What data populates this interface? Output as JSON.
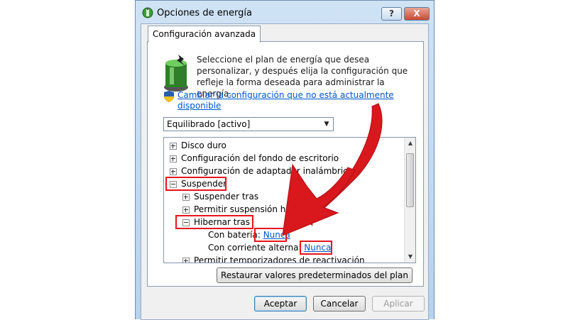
{
  "window": {
    "title": "Opciones de energía",
    "help_label": "?",
    "close_label": "X"
  },
  "tab": {
    "label": "Configuración avanzada"
  },
  "description": "Seleccione el plan de energía que desea personalizar, y después elija la configuración que refleje la forma deseada para administrar la energía.",
  "change_link": "Cambiar la configuración que no está actualmente disponible",
  "plan_select": {
    "value": "Equilibrado [activo]"
  },
  "tree": {
    "items": [
      {
        "label": "Disco duro",
        "expander": "plus"
      },
      {
        "label": "Configuración del fondo de escritorio",
        "expander": "plus"
      },
      {
        "label": "Configuración de adaptador inalámbrico",
        "expander": "plus"
      },
      {
        "label": "Suspender",
        "expander": "minus"
      },
      {
        "label": "Suspender tras",
        "expander": "plus"
      },
      {
        "label": "Permitir suspensión híbrida",
        "expander": "plus"
      },
      {
        "label": "Hibernar tras",
        "expander": "minus"
      },
      {
        "label": "Con batería:",
        "value": "Nunca"
      },
      {
        "label": "Con corriente alterna:",
        "value": "Nunca"
      },
      {
        "label": "Permitir temporizadores de reactivación",
        "expander": "plus"
      }
    ]
  },
  "buttons": {
    "restore": "Restaurar valores predeterminados del plan",
    "ok": "Aceptar",
    "cancel": "Cancelar",
    "apply": "Aplicar"
  },
  "colors": {
    "highlight": "#e8141c",
    "link": "#0055cc"
  }
}
